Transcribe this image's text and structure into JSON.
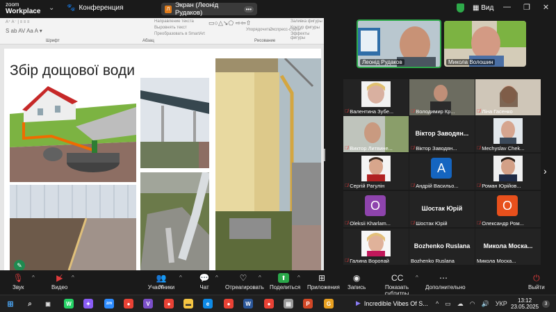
{
  "window": {
    "brand_line1": "zoom",
    "brand_line2": "Workplace",
    "conference_label": "Конференция",
    "screen_share_label": "Экран (Леонід Рудаков)",
    "screen_share_initial": "Л",
    "more_label": "•••",
    "view_label": "Вид",
    "accent_color": "#2eaa4a"
  },
  "shared_screen": {
    "ribbon": {
      "groups": [
        "Шрифт",
        "Абзац",
        "Рисование"
      ],
      "items": [
        "Направление текста",
        "Выровнять текст",
        "Преобразовать в SmartArt",
        "Упорядочить",
        "Экспресс-стили",
        "Заливка фигуры",
        "Контур фигуры",
        "Эффекты фигуры"
      ]
    },
    "slide_title": "Збір дощової води"
  },
  "speakers": [
    {
      "name": "Леонід Рудаков",
      "active": true
    },
    {
      "name": "Микола Волошин",
      "active": false
    }
  ],
  "gallery": [
    {
      "name": "Валентина Зубе...",
      "type": "video",
      "muted": true
    },
    {
      "name": "Володимир Кр...",
      "type": "video",
      "muted": true
    },
    {
      "name": "Ліна Гасенко",
      "type": "video",
      "muted": true
    },
    {
      "name": "Виктор Литвине...",
      "type": "video",
      "muted": true
    },
    {
      "name": "Віктор Заводян...",
      "display": "Віктор Заводян...",
      "type": "name",
      "muted": true
    },
    {
      "name": "Mechyslav Chek...",
      "type": "video",
      "muted": true
    },
    {
      "name": "Сергій Рагулін",
      "type": "video",
      "muted": true
    },
    {
      "name": "Андрій Васильо...",
      "type": "avatar",
      "initial": "A",
      "color": "#1565c0",
      "muted": true
    },
    {
      "name": "Роман Юрійов...",
      "type": "video",
      "muted": true
    },
    {
      "name": "Oleksii Kharlam...",
      "type": "avatar",
      "initial": "O",
      "color": "#8e44ad",
      "muted": true
    },
    {
      "name": "Шостак Юрій",
      "display": "Шостак Юрій",
      "type": "name",
      "muted": true
    },
    {
      "name": "Олександр Ром...",
      "type": "avatar",
      "initial": "O",
      "color": "#e8501c",
      "muted": true
    },
    {
      "name": "Галина Воропай",
      "type": "video",
      "muted": true
    },
    {
      "name": "Bozhenko Ruslana",
      "display": "Bozhenko Ruslana",
      "type": "name",
      "muted": false
    },
    {
      "name": "Микола Моска...",
      "display": "Микола Моска...",
      "type": "name",
      "muted": false
    }
  ],
  "toolbar": {
    "audio": "Звук",
    "video": "Видео",
    "participants": "Участники",
    "participants_count": "36",
    "chat": "Чат",
    "react": "Отреагировать",
    "share": "Поделиться",
    "apps": "Приложения",
    "record": "Запись",
    "captions": "Показать субтитры",
    "more": "Дополнительно",
    "leave": "Выйти"
  },
  "taskbar": {
    "media_title": "Incredible Vibes Of S...",
    "language": "УКР",
    "time": "13:12",
    "date": "23.05.2025",
    "notifications": "3"
  }
}
